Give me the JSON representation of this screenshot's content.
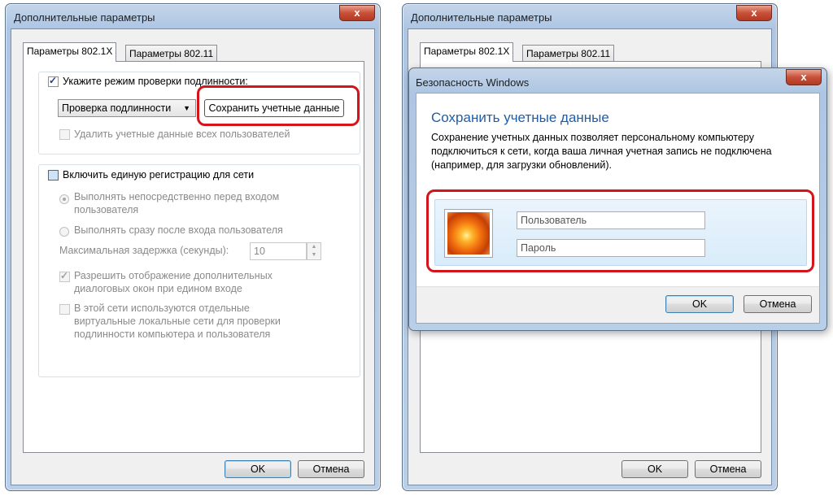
{
  "left_window": {
    "title": "Дополнительные параметры",
    "close": "x",
    "tabs": [
      "Параметры 802.1X",
      "Параметры 802.11"
    ],
    "auth_mode_checkbox": "Укажите режим проверки подлинности:",
    "auth_mode_select": "Проверка подлинности",
    "save_credentials_button": "Сохранить учетные данные",
    "delete_credentials_checkbox": "Удалить учетные данные всех пользователей",
    "sso_checkbox": "Включить единую регистрацию для сети",
    "radio_before": "Выполнять непосредственно перед входом пользователя",
    "radio_after": "Выполнять сразу после входа пользователя",
    "max_delay_label": "Максимальная задержка (секунды):",
    "max_delay_value": "10",
    "allow_dialogs": "Разрешить отображение дополнительных диалоговых окон при едином входе",
    "separate_vlan": "В этой сети используются отдельные виртуальные локальные сети для проверки подлинности компьютера и пользователя",
    "ok": "OK",
    "cancel": "Отмена"
  },
  "right_window": {
    "title": "Дополнительные параметры",
    "close": "x",
    "tabs": [
      "Параметры 802.1X",
      "Параметры 802.11"
    ],
    "ok": "OK",
    "cancel": "Отмена"
  },
  "security_dialog": {
    "title": "Безопасность Windows",
    "close": "x",
    "heading": "Сохранить учетные данные",
    "description": "Сохранение учетных данных позволяет персональному компьютеру подключиться к сети, когда ваша личная учетная запись не подключена (например, для загрузки обновлений).",
    "username_placeholder": "Пользователь",
    "password_placeholder": "Пароль",
    "ok": "OK",
    "cancel": "Отмена"
  },
  "colors": {
    "highlight": "#d4141b",
    "heading_blue": "#1f5da8"
  }
}
